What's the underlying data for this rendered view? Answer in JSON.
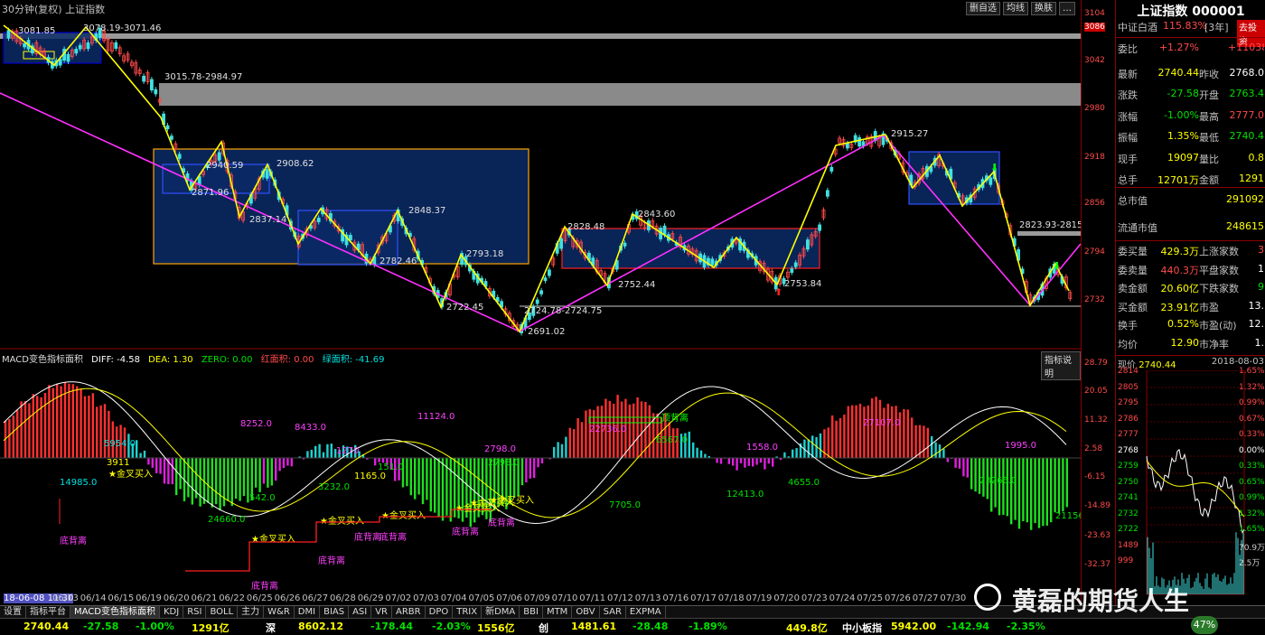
{
  "top": {
    "title": "30分钟(复权)  上证指数",
    "buttons": [
      "删自选",
      "均线",
      "换肤",
      "…"
    ]
  },
  "price_axis": [
    "3104",
    "3086",
    "3042",
    "2980",
    "2918",
    "2856",
    "2794",
    "2732"
  ],
  "price_labels": [
    {
      "t": "3081.85"
    },
    {
      "t": "3078.19-3071.46"
    },
    {
      "t": "3015.78-2984.97"
    },
    {
      "t": "2940.59"
    },
    {
      "t": "2908.62"
    },
    {
      "t": "2871.96"
    },
    {
      "t": "2837.14"
    },
    {
      "t": "2848.37"
    },
    {
      "t": "2782.46"
    },
    {
      "t": "2793.18"
    },
    {
      "t": "2722.45"
    },
    {
      "t": "2691.02"
    },
    {
      "t": "2724.78-2724.75"
    },
    {
      "t": "2828.48"
    },
    {
      "t": "2843.60"
    },
    {
      "t": "2752.44"
    },
    {
      "t": "2753.84"
    },
    {
      "t": "2915.27"
    },
    {
      "t": "2823.93-2815"
    }
  ],
  "indicator": {
    "name": "MACD变色指标面积",
    "diff": "DIFF: -4.58",
    "dea": "DEA: 1.30",
    "zero": "ZERO: 0.00",
    "red": "红面积: 0.00",
    "green": "绿面积: -41.69",
    "help": "指标说明",
    "axis": [
      "28.79",
      "20.05",
      "11.32",
      "2.58",
      "-6.15",
      "-14.89",
      "-23.63",
      "-32.37"
    ],
    "areas": [
      {
        "t": "5954.0",
        "c": "#00e0e0"
      },
      {
        "t": "3911",
        "c": "#ffff00"
      },
      {
        "t": "14985.0",
        "c": "#00e0e0"
      },
      {
        "t": "8252.0",
        "c": "#ff40ff"
      },
      {
        "t": "8433.0",
        "c": "#ff40ff"
      },
      {
        "t": "542.0",
        "c": "#00e000"
      },
      {
        "t": "24660.0",
        "c": "#00e000"
      },
      {
        "t": "1270",
        "c": "#ff40ff"
      },
      {
        "t": "3232.0",
        "c": "#00e000"
      },
      {
        "t": "1165.0",
        "c": "#ffff00"
      },
      {
        "t": "151.0",
        "c": "#00e000"
      },
      {
        "t": "11124.0",
        "c": "#ff40ff"
      },
      {
        "t": "2798.0",
        "c": "#ff40ff"
      },
      {
        "t": "2798.0",
        "c": "#00e000"
      },
      {
        "t": "22736.0",
        "c": "#ff40ff"
      },
      {
        "t": "6567.0",
        "c": "#00e000"
      },
      {
        "t": "7705.0",
        "c": "#00e000"
      },
      {
        "t": "1558.0",
        "c": "#ff40ff"
      },
      {
        "t": "12413.0",
        "c": "#00e000"
      },
      {
        "t": "4655.0",
        "c": "#00e000"
      },
      {
        "t": "27107.0",
        "c": "#ff40ff"
      },
      {
        "t": "1995.0",
        "c": "#ff40ff"
      },
      {
        "t": "23266.0",
        "c": "#00e000"
      },
      {
        "t": "21156",
        "c": "#00e000"
      }
    ],
    "signals": [
      "金叉买入",
      "金叉买入",
      "金叉买入",
      "金叉买入",
      "金叉买入",
      "金叉买入",
      "金叉买入"
    ],
    "divergences": [
      "底背离",
      "底背离",
      "底背离",
      "底背离",
      "底背离",
      "底背离",
      "底背离",
      "顶背离"
    ]
  },
  "dates": [
    "18-06-08 11:30",
    "06/13",
    "06/14",
    "06/15",
    "06/19",
    "06/20",
    "06/21",
    "06/22",
    "06/25",
    "06/26",
    "06/27",
    "06/28",
    "06/29",
    "07/02",
    "07/03",
    "07/04",
    "07/05",
    "07/06",
    "07/09",
    "07/10",
    "07/11",
    "07/12",
    "07/13",
    "07/16",
    "07/17",
    "07/18",
    "07/19",
    "07/20",
    "07/23",
    "07/24",
    "07/25",
    "07/26",
    "07/27",
    "07/30"
  ],
  "tabs": [
    "设置",
    "指标平台",
    "MACD变色指标面积",
    "KDJ",
    "RSI",
    "BOLL",
    "主力",
    "W&R",
    "DMI",
    "BIAS",
    "ASI",
    "VR",
    "ARBR",
    "DPO",
    "TRIX",
    "新DMA",
    "BBI",
    "MTM",
    "OBV",
    "SAR",
    "EXPMA"
  ],
  "status": [
    {
      "t": "2740.44",
      "c": "#ffff00"
    },
    {
      "t": "-27.58",
      "c": "#00e000"
    },
    {
      "t": "-1.00%",
      "c": "#00e000"
    },
    {
      "t": "1291亿",
      "c": "#ffff00"
    },
    {
      "t": "深",
      "c": "#ffffff"
    },
    {
      "t": "8602.12",
      "c": "#ffff00"
    },
    {
      "t": "-178.44",
      "c": "#00e000"
    },
    {
      "t": "-2.03%",
      "c": "#00e000"
    },
    {
      "t": "1556亿",
      "c": "#ffff00"
    },
    {
      "t": "创",
      "c": "#ffffff"
    },
    {
      "t": "1481.61",
      "c": "#ffff00"
    },
    {
      "t": "-28.48",
      "c": "#00e000"
    },
    {
      "t": "-1.89%",
      "c": "#00e000"
    },
    {
      "t": "449.8亿",
      "c": "#ffff00"
    },
    {
      "t": "中小板指",
      "c": "#ffffff"
    },
    {
      "t": "5942.00",
      "c": "#ffff00"
    },
    {
      "t": "-142.94",
      "c": "#00e000"
    },
    {
      "t": "-2.35%",
      "c": "#00e000"
    }
  ],
  "badge": "47%",
  "watermark": "黄磊的期货人生",
  "panel": {
    "title": "上证指数 000001",
    "sub_label": "中证白酒",
    "sub_value": "115.83%",
    "sub_period": "[3年]",
    "sub_btn": "去投资",
    "rows": [
      {
        "l": "委比",
        "v": "+1.27%",
        "vc": "#ff4a4a",
        "l2": "",
        "v2": "+11038",
        "v2c": "#ff4a4a"
      },
      {
        "l": "最新",
        "v": "2740.44",
        "vc": "#ffff00",
        "l2": "昨收",
        "v2": "2768.0",
        "v2c": "#ffffff"
      },
      {
        "l": "涨跌",
        "v": "-27.58",
        "vc": "#00e000",
        "l2": "开盘",
        "v2": "2763.4",
        "v2c": "#00e000"
      },
      {
        "l": "涨幅",
        "v": "-1.00%",
        "vc": "#00e000",
        "l2": "最高",
        "v2": "2777.0",
        "v2c": "#ff4a4a"
      },
      {
        "l": "振幅",
        "v": "1.35%",
        "vc": "#ffff00",
        "l2": "最低",
        "v2": "2740.4",
        "v2c": "#00e000"
      },
      {
        "l": "现手",
        "v": "19097",
        "vc": "#ffff00",
        "l2": "量比",
        "v2": "0.8",
        "v2c": "#ffff00"
      },
      {
        "l": "总手",
        "v": "12701万",
        "vc": "#ffff00",
        "l2": "金额",
        "v2": "1291",
        "v2c": "#ffff00"
      }
    ],
    "cap_rows": [
      {
        "l": "总市值",
        "v": "291092"
      },
      {
        "l": "流通市值",
        "v": "248615"
      }
    ],
    "rows2": [
      {
        "l": "委买量",
        "v": "429.3万",
        "vc": "#ffff00",
        "l2": "上涨家数",
        "v2": "3",
        "v2c": "#ff4a4a"
      },
      {
        "l": "委卖量",
        "v": "440.3万",
        "vc": "#ff4a4a",
        "l2": "平盘家数",
        "v2": "1",
        "v2c": "#ffffff"
      },
      {
        "l": "卖金额",
        "v": "20.60亿",
        "vc": "#ffff00",
        "l2": "下跌家数",
        "v2": "9",
        "v2c": "#00e000"
      },
      {
        "l": "买金额",
        "v": "23.91亿",
        "vc": "#ffff00",
        "l2": "市盈",
        "v2": "13.",
        "v2c": "#ffffff"
      },
      {
        "l": "换手",
        "v": "0.52%",
        "vc": "#ffff00",
        "l2": "市盈(动)",
        "v2": "12.",
        "v2c": "#ffffff"
      },
      {
        "l": "均价",
        "v": "12.90",
        "vc": "#ffff00",
        "l2": "市净率",
        "v2": "1.",
        "v2c": "#ffffff"
      }
    ],
    "mini": {
      "now_label": "现价",
      "now_value": "2740.44",
      "date": "2018-08-03",
      "left_axis": [
        "2814",
        "2805",
        "2795",
        "2786",
        "2777",
        "2768",
        "2759",
        "2750",
        "2741",
        "2732",
        "2722",
        "1489",
        "999"
      ],
      "right_axis": [
        "1.65%",
        "1.32%",
        "0.99%",
        "0.67%",
        "0.33%",
        "0.00%",
        "0.33%",
        "0.65%",
        "0.99%",
        "1.32%",
        "1.65%",
        "70.9万",
        "2.5万"
      ]
    }
  }
}
